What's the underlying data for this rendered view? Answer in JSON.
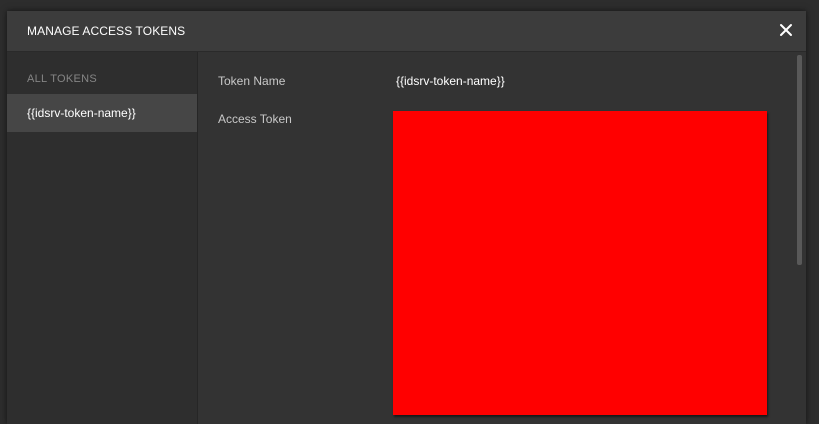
{
  "modal": {
    "title": "MANAGE ACCESS TOKENS",
    "close_icon": "close-icon"
  },
  "sidebar": {
    "heading": "ALL TOKENS",
    "items": [
      {
        "label": "{{idsrv-token-name}}",
        "selected": true
      }
    ]
  },
  "details": {
    "token_name_label": "Token Name",
    "token_name_value": "{{idsrv-token-name}}",
    "access_token_label": "Access Token"
  },
  "colors": {
    "accent_redaction": "#ff0000",
    "background": "#333333",
    "selected_item": "#464646"
  }
}
